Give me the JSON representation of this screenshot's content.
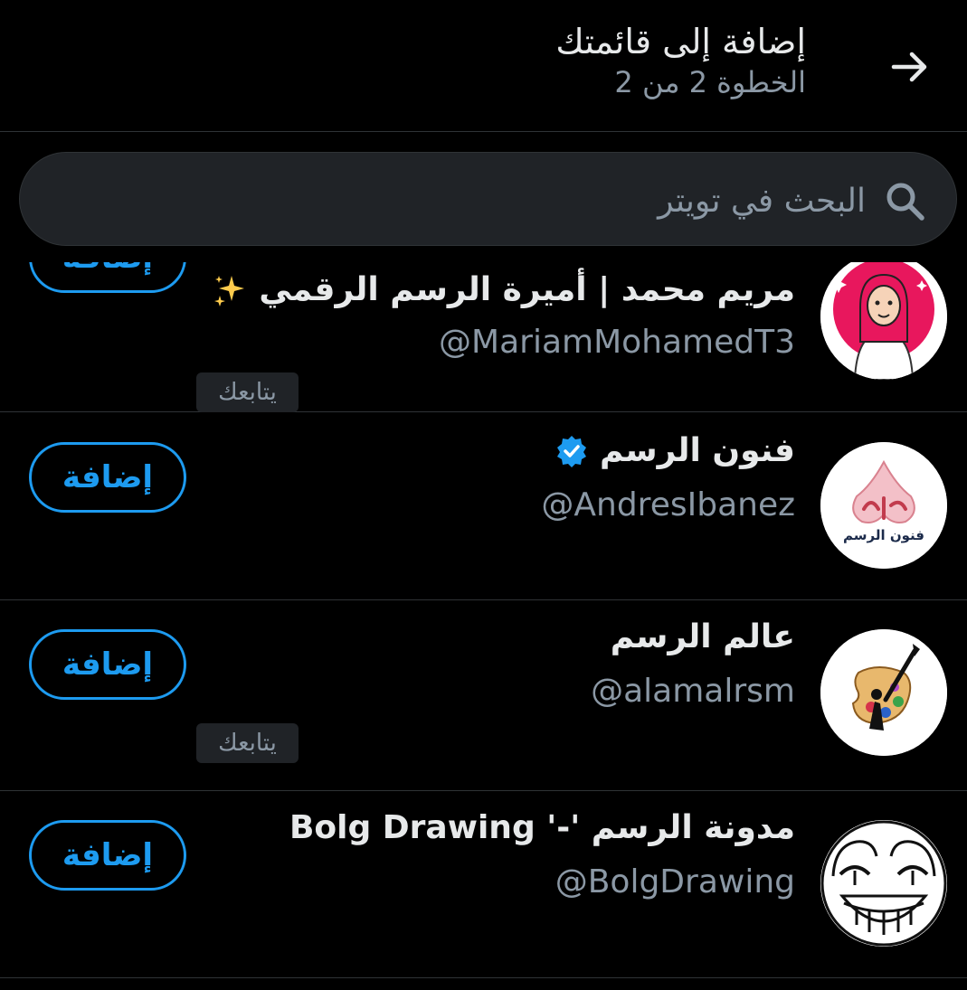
{
  "header": {
    "title": "إضافة إلى قائمتك",
    "subtitle": "الخطوة 2 من 2"
  },
  "search": {
    "placeholder": "البحث في تويتر"
  },
  "colors": {
    "background": "#000000",
    "accent": "#1d9bf0",
    "muted": "#8b98a5",
    "divider": "#2f3336"
  },
  "users": [
    {
      "name": "مريم محمد | أميرة الرسم الرقمي",
      "handle": "@MariamMohamedT3",
      "badge_icon": "sparkles-icon",
      "follows_you": "يتابعك",
      "add_label": "إضافة"
    },
    {
      "name": "فنون الرسم",
      "handle": "@AndresIbanez",
      "badge_icon": "verified-icon",
      "add_label": "إضافة",
      "avatar_text": "فنون الرسم"
    },
    {
      "name": "عالم الرسم",
      "handle": "@alamalrsm",
      "follows_you": "يتابعك",
      "add_label": "إضافة"
    },
    {
      "name": "مدونة الرسم '-' Bolg Drawing",
      "handle": "@BolgDrawing",
      "add_label": "إضافة"
    }
  ]
}
